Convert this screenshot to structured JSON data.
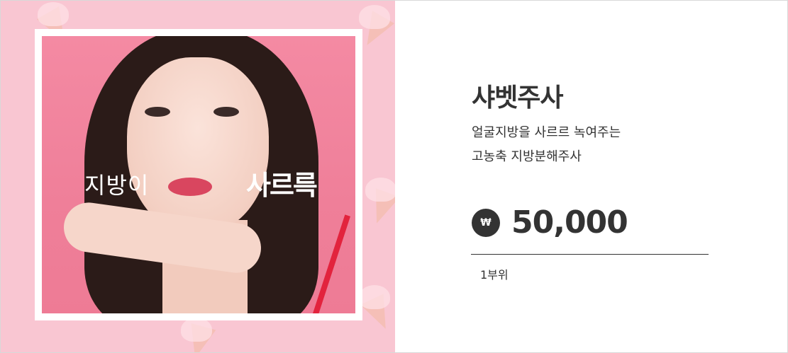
{
  "product": {
    "title": "샤벳주사",
    "description_lines": [
      "얼굴지방을 사르르 녹여주는",
      "고농축 지방분해주사"
    ],
    "currency_symbol": "₩",
    "price": "50,000",
    "unit": "1부위"
  },
  "image": {
    "overlay_text_left": "지방이",
    "overlay_text_right": "사르륵"
  },
  "colors": {
    "background_pink": "#f9c6d2",
    "photo_pink": "#f48aa3",
    "text_dark": "#333333",
    "white": "#ffffff"
  },
  "icons": {
    "currency": "won-sign-badge"
  }
}
